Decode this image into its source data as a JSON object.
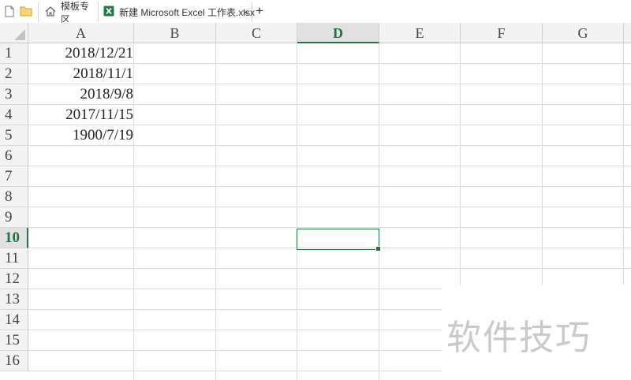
{
  "tabs": {
    "home_label": "模板专区",
    "file_label": "新建 Microsoft Excel 工作表.xlsx",
    "close_glyph": "×",
    "add_glyph": "+"
  },
  "columns": [
    "A",
    "B",
    "C",
    "D",
    "E",
    "F",
    "G"
  ],
  "active_column": "D",
  "rows": [
    "1",
    "2",
    "3",
    "4",
    "5",
    "6",
    "7",
    "8",
    "9",
    "10",
    "11",
    "12",
    "13",
    "14",
    "15",
    "16"
  ],
  "active_row": "10",
  "column_a_values": [
    "2018/12/21",
    "2018/11/1",
    "2018/9/8",
    "2017/11/15",
    "1900/7/19"
  ],
  "selected_cell": "D10",
  "watermark": "软件技巧",
  "colors": {
    "accent": "#217346",
    "header_bg": "#f3f3f3",
    "gridline": "#dadada"
  }
}
